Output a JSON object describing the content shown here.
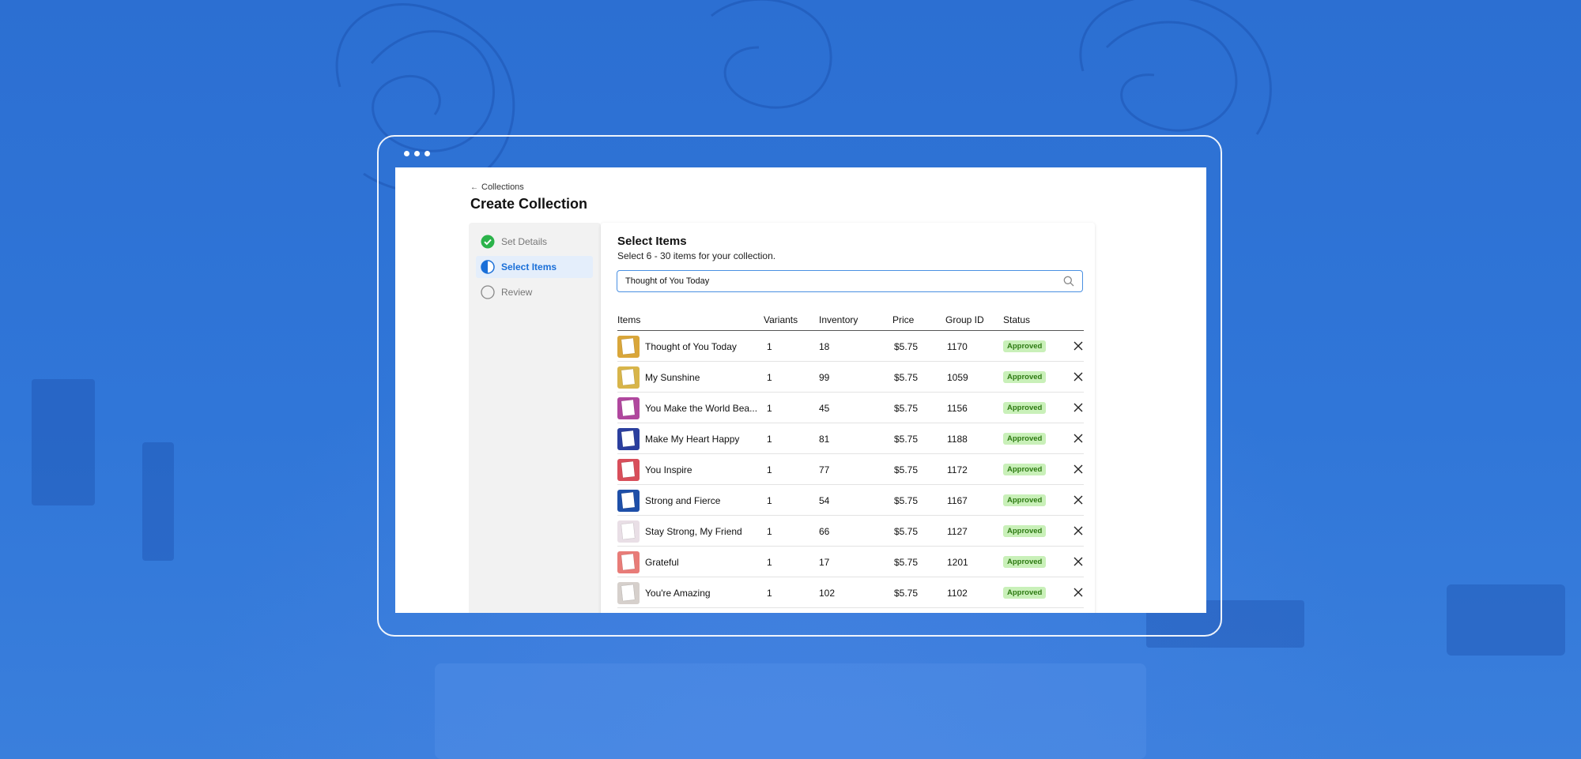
{
  "window": {
    "breadcrumb": "Collections",
    "title": "Create Collection"
  },
  "steps": [
    {
      "label": "Set Details",
      "state": "done"
    },
    {
      "label": "Select Items",
      "state": "active"
    },
    {
      "label": "Review",
      "state": "pending"
    }
  ],
  "select_items": {
    "title": "Select Items",
    "subtitle": "Select 6 - 30 items for your collection.",
    "search_value": "Thought of You Today"
  },
  "table": {
    "headers": {
      "items": "Items",
      "variants": "Variants",
      "inventory": "Inventory",
      "price": "Price",
      "group_id": "Group ID",
      "status": "Status"
    },
    "rows": [
      {
        "name": "Thought of You Today",
        "variants": "1",
        "inventory": "18",
        "price": "$5.75",
        "group_id": "1170",
        "status": "Approved",
        "thumb": "#d9a63a"
      },
      {
        "name": "My Sunshine",
        "variants": "1",
        "inventory": "99",
        "price": "$5.75",
        "group_id": "1059",
        "status": "Approved",
        "thumb": "#d8b54a"
      },
      {
        "name": "You Make the World Bea...",
        "variants": "1",
        "inventory": "45",
        "price": "$5.75",
        "group_id": "1156",
        "status": "Approved",
        "thumb": "#b0479e"
      },
      {
        "name": "Make My Heart Happy",
        "variants": "1",
        "inventory": "81",
        "price": "$5.75",
        "group_id": "1188",
        "status": "Approved",
        "thumb": "#2b3f9e"
      },
      {
        "name": "You Inspire",
        "variants": "1",
        "inventory": "77",
        "price": "$5.75",
        "group_id": "1172",
        "status": "Approved",
        "thumb": "#d84e5a"
      },
      {
        "name": "Strong and Fierce",
        "variants": "1",
        "inventory": "54",
        "price": "$5.75",
        "group_id": "1167",
        "status": "Approved",
        "thumb": "#1e4fa8"
      },
      {
        "name": "Stay Strong, My Friend",
        "variants": "1",
        "inventory": "66",
        "price": "$5.75",
        "group_id": "1127",
        "status": "Approved",
        "thumb": "#e9dfe6"
      },
      {
        "name": "Grateful",
        "variants": "1",
        "inventory": "17",
        "price": "$5.75",
        "group_id": "1201",
        "status": "Approved",
        "thumb": "#e87c78"
      },
      {
        "name": "You're Amazing",
        "variants": "1",
        "inventory": "102",
        "price": "$5.75",
        "group_id": "1102",
        "status": "Approved",
        "thumb": "#d6d0cc"
      }
    ]
  },
  "colors": {
    "accent": "#1a6fd8",
    "success": "#2bb34a",
    "badge_bg": "#c9f0b9",
    "badge_text": "#2d7a12",
    "background": "#2f74d6"
  },
  "icons": {
    "back": "arrow-left-icon",
    "search": "search-icon",
    "remove": "close-icon",
    "done": "check-circle-icon",
    "active": "half-circle-icon",
    "pending": "empty-circle-icon"
  }
}
